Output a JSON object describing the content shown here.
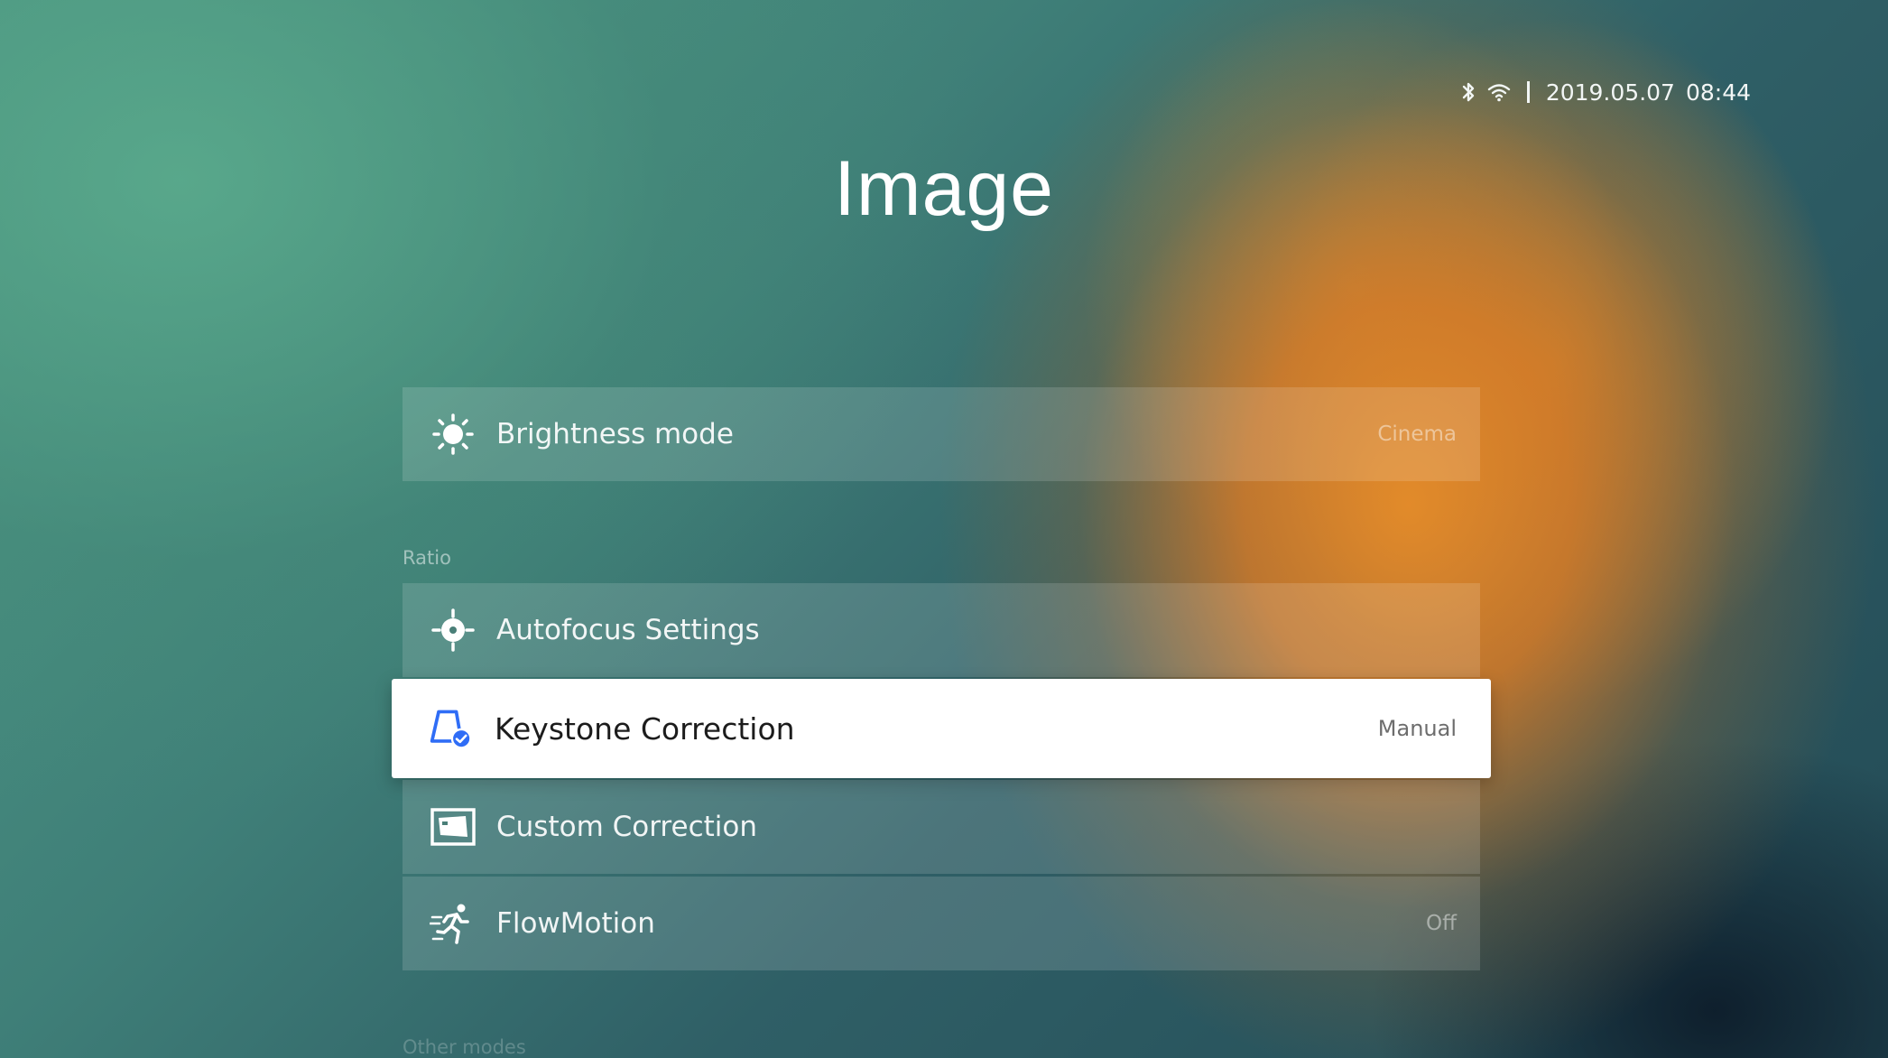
{
  "status_bar": {
    "icons": [
      "bluetooth-icon",
      "wifi-icon"
    ],
    "date": "2019.05.07",
    "time": "08:44"
  },
  "title": "Image",
  "menu": {
    "brightness": {
      "label": "Brightness mode",
      "value": "Cinema",
      "icon": "sun-icon"
    },
    "ratio_section_label": "Ratio",
    "autofocus": {
      "label": "Autofocus Settings",
      "value": "",
      "icon": "focus-target-icon"
    },
    "keystone": {
      "label": "Keystone Correction",
      "value": "Manual",
      "icon": "keystone-icon"
    },
    "custom": {
      "label": "Custom Correction",
      "value": "",
      "icon": "custom-correction-icon"
    },
    "flowmotion": {
      "label": "FlowMotion",
      "value": "Off",
      "icon": "running-figure-icon"
    },
    "other_section_label": "Other modes"
  },
  "colors": {
    "accent": "#2f6df6",
    "selected_bg": "#ffffff"
  }
}
